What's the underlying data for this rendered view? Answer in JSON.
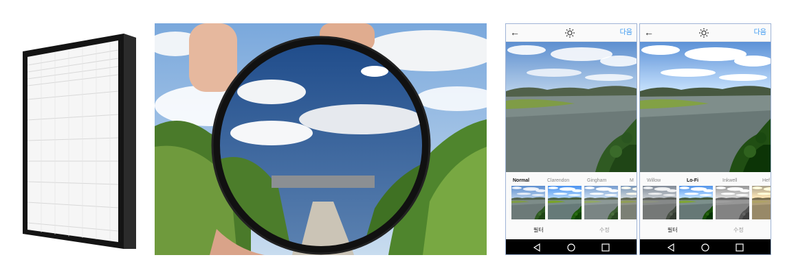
{
  "phone_left": {
    "header": {
      "back_icon": "arrow-left-icon",
      "brightness_icon": "sun-icon",
      "next_label": "다음"
    },
    "filters": [
      "Normal",
      "Clarendon",
      "Gingham",
      "M"
    ],
    "selected_filter": "Normal",
    "tabs": {
      "filter_label": "필터",
      "edit_label": "수정"
    }
  },
  "phone_right": {
    "header": {
      "back_icon": "arrow-left-icon",
      "brightness_icon": "sun-icon",
      "next_label": "다음"
    },
    "filters": [
      "Willow",
      "Lo-Fi",
      "Inkwell",
      "Hef"
    ],
    "selected_filter": "Lo-Fi",
    "tabs": {
      "filter_label": "필터",
      "edit_label": "수정"
    }
  },
  "navbar_icons": [
    "triangle-back-icon",
    "circle-home-icon",
    "square-recents-icon"
  ],
  "colors": {
    "link_blue": "#3897f0",
    "phone_border": "#9fb4d6",
    "navbar": "#000000"
  }
}
